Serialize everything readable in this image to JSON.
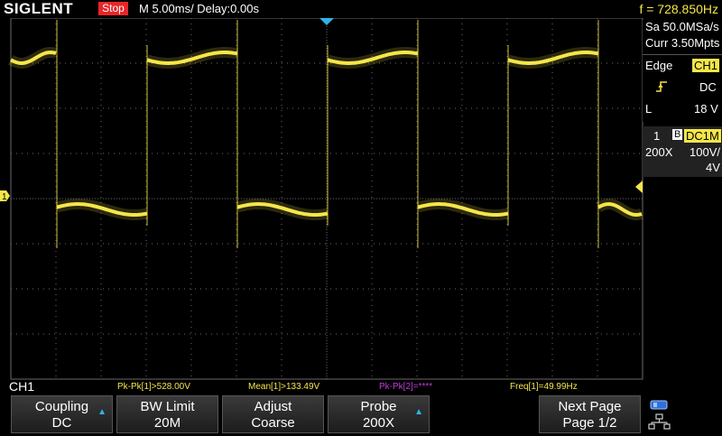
{
  "topbar": {
    "brand": "SIGLENT",
    "run_state": "Stop",
    "timebase": "M 5.00ms/ Delay:0.00s",
    "frequency": "f = 728.850Hz"
  },
  "acquisition": {
    "sample_rate": "Sa 50.0MSa/s",
    "memory": "Curr 3.50Mpts"
  },
  "trigger": {
    "type": "Edge",
    "source": "CH1",
    "coupling": "DC",
    "slope_icon": "rising-edge-icon",
    "level_label": "L",
    "level": "18 V"
  },
  "channel": {
    "number": "1",
    "bw_marker": "B",
    "coupling": "DC1M",
    "probe": "200X",
    "scale": "100V/",
    "offset": "4V"
  },
  "markers": {
    "ch1_ground": "1"
  },
  "measurements": {
    "channel_label": "CH1",
    "pkpk1": "Pk-Pk[1]>528.00V",
    "mean1": "Mean[1]>133.49V",
    "pkpk2": "Pk-Pk[2]=****",
    "freq1": "Freq[1]=49.99Hz"
  },
  "softkeys": [
    {
      "title": "Coupling",
      "value": "DC",
      "has_arrow": true
    },
    {
      "title": "BW Limit",
      "value": "20M",
      "has_arrow": false
    },
    {
      "title": "Adjust",
      "value": "Coarse",
      "has_arrow": false
    },
    {
      "title": "Probe",
      "value": "200X",
      "has_arrow": true
    },
    {
      "title": "Next Page",
      "value": "Page 1/2",
      "has_arrow": false
    }
  ],
  "colors": {
    "trace": "#f5e64a",
    "grid": "#6a6a6a",
    "accent": "#2fb4e8",
    "stop": "#e8262a"
  }
}
